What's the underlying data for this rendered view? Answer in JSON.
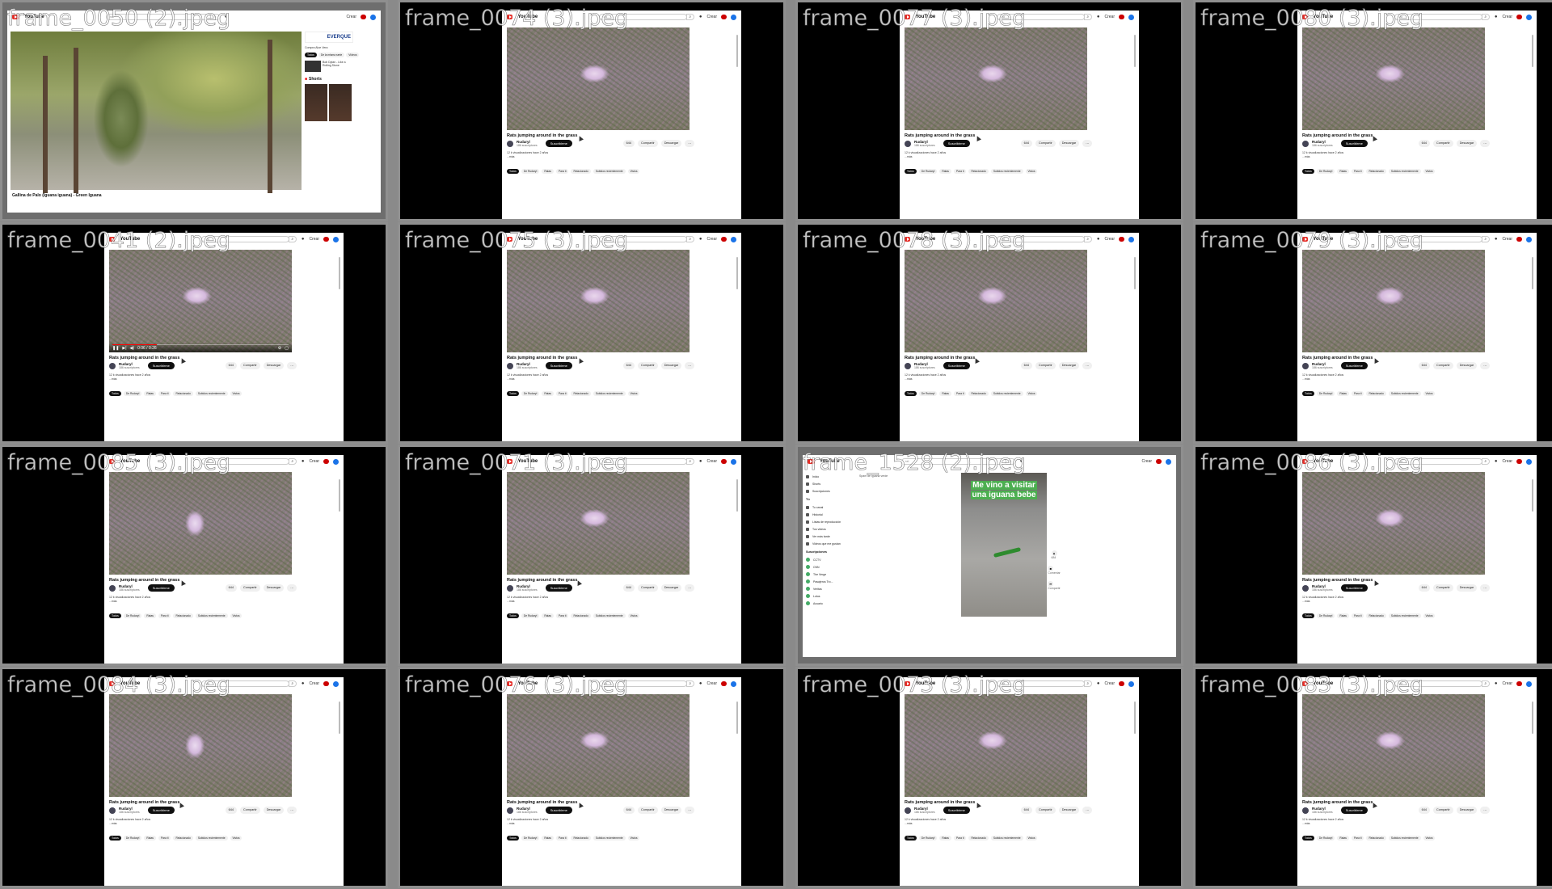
{
  "tiles": [
    {
      "label": "frame_0050 (2).jpeg",
      "kind": "iguana"
    },
    {
      "label": "frame_0074 (3).jpeg",
      "kind": "rat"
    },
    {
      "label": "frame_0077 (3).jpeg",
      "kind": "rat"
    },
    {
      "label": "frame_0080 (3).jpeg",
      "kind": "rat"
    },
    {
      "label": "frame_0041 (2).jpeg",
      "kind": "rat-controls"
    },
    {
      "label": "frame_0075 (3).jpeg",
      "kind": "rat"
    },
    {
      "label": "frame_0078 (3).jpeg",
      "kind": "rat"
    },
    {
      "label": "frame_0079 (3).jpeg",
      "kind": "rat"
    },
    {
      "label": "frame_0085 (3).jpeg",
      "kind": "rat-2"
    },
    {
      "label": "frame_0071 (3).jpeg",
      "kind": "rat"
    },
    {
      "label": "frame_1528 (2).jpeg",
      "kind": "shorts"
    },
    {
      "label": "frame_0086 (3).jpeg",
      "kind": "rat"
    },
    {
      "label": "frame_0084 (3).jpeg",
      "kind": "rat-2"
    },
    {
      "label": "frame_0076 (3).jpeg",
      "kind": "rat"
    },
    {
      "label": "frame_0073 (3).jpeg",
      "kind": "rat"
    },
    {
      "label": "frame_0083 (3).jpeg",
      "kind": "rat"
    }
  ],
  "youtube": {
    "brand": "YouTube",
    "search_placeholder": "rat",
    "search_icon": "search-icon",
    "mic_icon": "mic-icon",
    "create_label": "Crear",
    "video_title": "Rats jumping around in the grass",
    "channel_name": "Rudaryl",
    "channel_subs": "186 suscriptores",
    "subscribe_label": "Suscribirme",
    "likes": "644",
    "share_label": "Compartir",
    "download_label": "Descargar",
    "views_line": "12 k visualizaciones hace 2 años",
    "more_label": "...más",
    "time": "0:06 / 0:26",
    "progress": 0.25,
    "chips": [
      "Todos",
      "De Rudaryl",
      "Ratas",
      "Para ti",
      "Relacionado",
      "Subidos recientemente",
      "Vistos"
    ]
  },
  "iguana": {
    "title": "Gallina de Palo (Iguana iguana) - Green Iguana",
    "ad_title": "EVERQUE",
    "ad_sub": "Compra Aloe Vera",
    "rows": [
      "Todos",
      "De la misma serie",
      "Vídeos"
    ],
    "row_text": "Bob Dylan - Like a Rolling Stone",
    "shorts_label": "Shorts"
  },
  "shorts": {
    "caption": "Me vino a visitar una iguana bebe",
    "crumb": "Spam de iguana verde",
    "nav": [
      "Inicio",
      "Shorts",
      "Suscripciones"
    ],
    "you_label": "Tú",
    "you_items": [
      "Tu canal",
      "Historial",
      "Listas de reproducción",
      "Tus videos",
      "Ver más tarde",
      "Videos que me gustan"
    ],
    "subs_label": "Suscripciones",
    "subs": [
      "CCTV",
      "CNN",
      "The Verge",
      "Pasajeros Tro...",
      "Veritas",
      "Lotus",
      "Acuario"
    ],
    "actions": [
      "684",
      "Comentar",
      "Compartir"
    ]
  }
}
